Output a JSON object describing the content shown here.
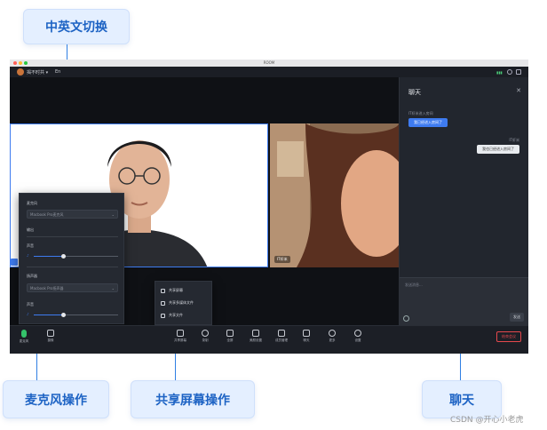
{
  "callouts": {
    "lang_switch": "中英文切换",
    "mic_ops": "麦克风操作",
    "share_ops": "共享屏幕操作",
    "chat": "聊天"
  },
  "window": {
    "title": "ROOM"
  },
  "topbar": {
    "meeting_name": "揭不时共 ▾",
    "lang_label": "En"
  },
  "remote_tile": {
    "name": "IT虾米"
  },
  "chat_panel": {
    "title": "聊天",
    "close": "✕",
    "sys_msg_1": "IT虾米进入房间",
    "bubble_1": "我已经进入房间了",
    "sys_msg_2": "IT虾米",
    "bubble_2": "我也已经进入房间了",
    "input_placeholder": "发送消息...",
    "send_label": "发送"
  },
  "mic_popup": {
    "mic_label": "麦克风",
    "mic_device": "Macbook Pro麦克风",
    "output_label": "输出",
    "volume_label": "声音",
    "input_volume": 0.35,
    "speaker_label": "扬声器",
    "speaker_device": "Macbook Pro扬声器",
    "speaker_volume_label": "声音",
    "speaker_volume": 0.35
  },
  "share_popup": {
    "items": [
      "共享屏幕",
      "共享多媒体文件",
      "共享文件"
    ]
  },
  "toolbar": {
    "mic": "麦克风",
    "camera": "摄像",
    "items": [
      "共享屏幕",
      "录制",
      "全屏",
      "美颜设置",
      "成员管理",
      "聊天",
      "更多",
      "设置"
    ],
    "end_label": "结束会议"
  },
  "colors": {
    "accent": "#3e7bf0",
    "mic_on": "#34c26a",
    "danger": "#e5484d"
  },
  "watermark": "CSDN @开心小老虎"
}
